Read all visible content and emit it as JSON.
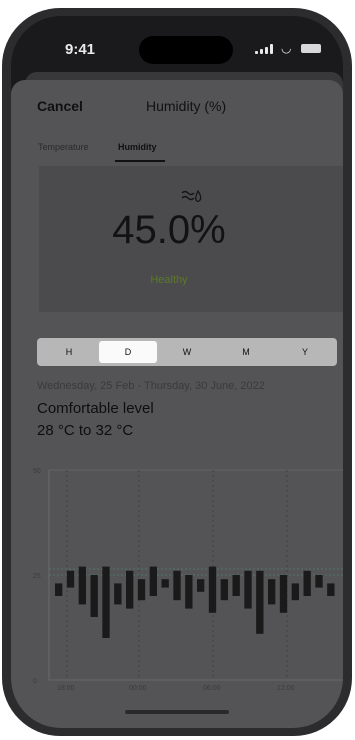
{
  "status": {
    "time": "9:41"
  },
  "nav": {
    "cancel": "Cancel",
    "title": "Humidity (%)"
  },
  "tabs": [
    {
      "label": "Temperature",
      "active": false
    },
    {
      "label": "Humidity",
      "active": true
    }
  ],
  "hero": {
    "value": "45.0%",
    "status": "Healthy",
    "icon": "humidity-icon"
  },
  "periods": [
    {
      "label": "H",
      "active": false
    },
    {
      "label": "D",
      "active": true
    },
    {
      "label": "W",
      "active": false
    },
    {
      "label": "M",
      "active": false
    },
    {
      "label": "Y",
      "active": false
    }
  ],
  "summary": {
    "range": "Wednesday, 25 Feb - Thursday, 30 June, 2022",
    "level_title": "Comfortable level",
    "level_value": "28 °C to 32 °C"
  },
  "chart_data": {
    "type": "bar",
    "y_ticks": [
      "50",
      "25",
      "0"
    ],
    "ylim": [
      0,
      50
    ],
    "x_ticks": [
      "18:00",
      "00:00",
      "06:00",
      "12:00"
    ],
    "reference_line": 25,
    "bars": [
      [
        20,
        23
      ],
      [
        22,
        26
      ],
      [
        18,
        27
      ],
      [
        15,
        25
      ],
      [
        10,
        27
      ],
      [
        18,
        23
      ],
      [
        17,
        26
      ],
      [
        19,
        24
      ],
      [
        20,
        27
      ],
      [
        22,
        24
      ],
      [
        19,
        26
      ],
      [
        17,
        25
      ],
      [
        21,
        24
      ],
      [
        16,
        27
      ],
      [
        19,
        24
      ],
      [
        20,
        25
      ],
      [
        17,
        26
      ],
      [
        11,
        26
      ],
      [
        18,
        24
      ],
      [
        16,
        25
      ],
      [
        19,
        23
      ],
      [
        20,
        26
      ],
      [
        22,
        25
      ],
      [
        20,
        23
      ]
    ],
    "colors": {
      "bar": "#1a1a1a",
      "reference": "#4a9a7a",
      "grid": "#7a7a7a"
    }
  }
}
